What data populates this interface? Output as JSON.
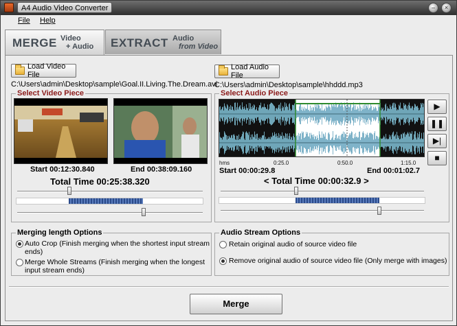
{
  "window": {
    "title": "A4 Audio Video Converter",
    "minimize": "–",
    "close": "×"
  },
  "menu": {
    "file": "File",
    "help": "Help"
  },
  "tabs": {
    "merge": {
      "big": "MERGE",
      "line1": "Video",
      "line2": "+ Audio"
    },
    "extract": {
      "big": "EXTRACT",
      "line1": "Audio",
      "line2": "from Video"
    }
  },
  "video": {
    "load_label": "Load Video File",
    "path": "C:\\Users\\admin\\Desktop\\sample\\Goal.II.Living.The.Dream.avi",
    "group_title": "Select Video Piece",
    "start": "Start 00:12:30.840",
    "end": "End 00:38:09.160",
    "total": "Total Time 00:25:38.320",
    "start_fraction": 0.28,
    "end_fraction": 0.68
  },
  "audio": {
    "load_label": "Load Audio File",
    "path": "C:\\Users\\admin\\Desktop\\sample\\hhddd.mp3",
    "group_title": "Select Audio Piece",
    "ruler": [
      "hms",
      "0:25.0",
      "0:50.0",
      "1:15.0"
    ],
    "start": "Start 00:00:29.8",
    "end": "End 00:01:02.7",
    "total": "< Total Time 00:00:32.9 >",
    "start_fraction": 0.37,
    "end_fraction": 0.78
  },
  "controls": {
    "play": "▶",
    "pause": "❚❚",
    "step": "▶|",
    "stop": "■"
  },
  "merge_options": {
    "title": "Merging length Options",
    "auto_crop": "Auto Crop (Finish merging when the shortest input stream ends)",
    "whole": "Merge Whole Streams (Finish merging when the longest input stream ends)"
  },
  "audio_options": {
    "title": "Audio Stream Options",
    "retain": "Retain original audio of source video file",
    "remove": "Remove original audio of source video file (Only merge with images)"
  },
  "merge_button": "Merge"
}
